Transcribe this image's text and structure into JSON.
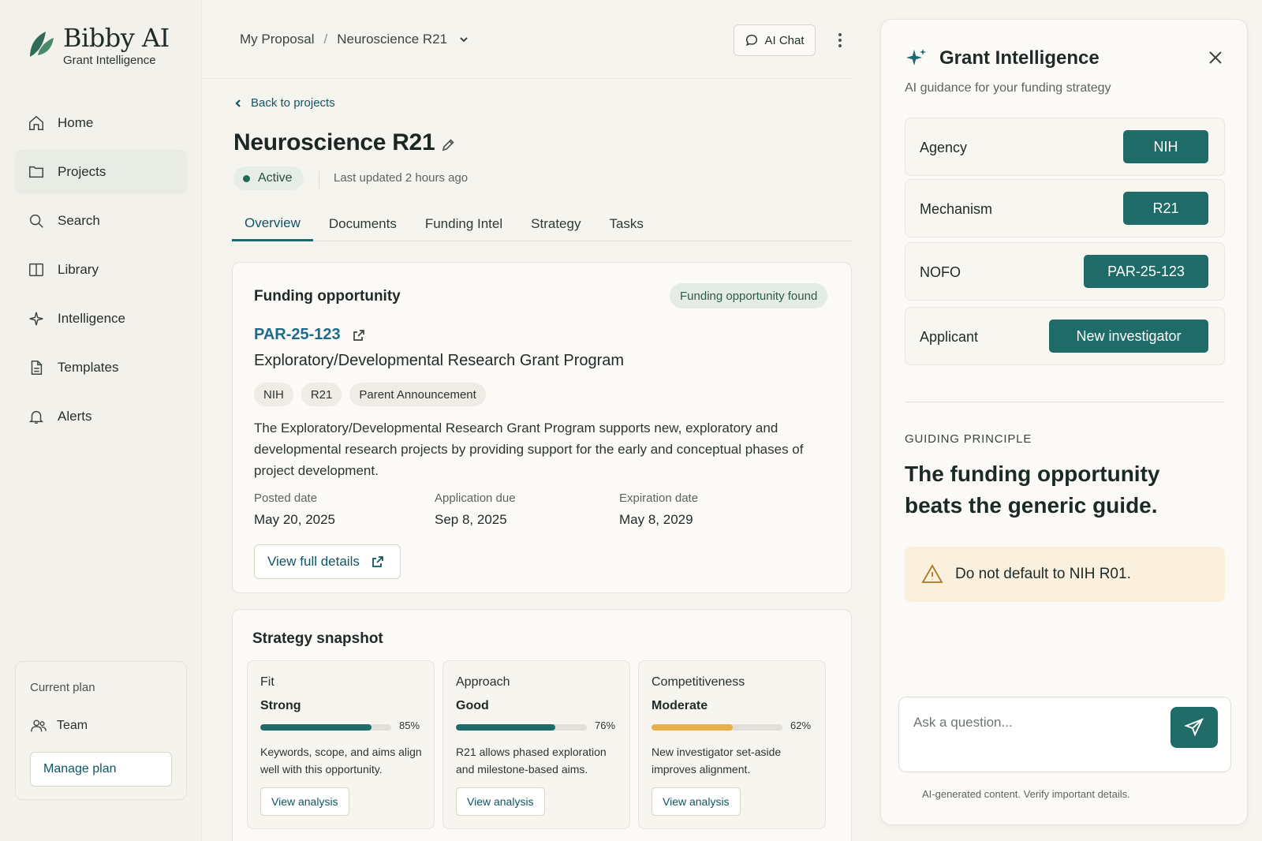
{
  "brand": {
    "name": "Bibby AI",
    "subtitle": "Grant Intelligence"
  },
  "sidebar": {
    "items": [
      {
        "label": "Home",
        "icon": "home-icon"
      },
      {
        "label": "Projects",
        "icon": "folder-icon",
        "active": true
      },
      {
        "label": "Search",
        "icon": "search-icon"
      },
      {
        "label": "Library",
        "icon": "book-icon"
      },
      {
        "label": "Intelligence",
        "icon": "sparkle-icon"
      },
      {
        "label": "Templates",
        "icon": "document-icon"
      },
      {
        "label": "Alerts",
        "icon": "bell-icon"
      }
    ],
    "plan": {
      "label": "Current plan",
      "name": "Team",
      "button": "Manage plan"
    }
  },
  "topbar": {
    "breadcrumb_root": "My Proposal",
    "breadcrumb_sep": "/",
    "breadcrumb_current": "Neuroscience R21",
    "ai_chat": "AI Chat"
  },
  "project": {
    "back": "Back to projects",
    "title": "Neuroscience R21",
    "status": "Active",
    "updated": "Last updated 2 hours ago",
    "tabs": [
      "Overview",
      "Documents",
      "Funding Intel",
      "Strategy",
      "Tasks"
    ],
    "active_tab": "Overview"
  },
  "funding": {
    "title": "Funding opportunity",
    "badge": "Funding opportunity found",
    "nofo": "PAR-25-123",
    "program": "Exploratory/Developmental Research Grant Program",
    "chips": [
      "NIH",
      "R21",
      "Parent Announcement"
    ],
    "description": "The Exploratory/Developmental Research Grant Program supports new, exploratory and developmental research projects by providing support for the early and conceptual phases of project development.",
    "dates": [
      {
        "label": "Posted date",
        "value": "May 20, 2025"
      },
      {
        "label": "Application due",
        "value": "Sep 8, 2025"
      },
      {
        "label": "Expiration date",
        "value": "May 8, 2029"
      }
    ],
    "view_button": "View full details"
  },
  "strategy": {
    "title": "Strategy snapshot",
    "metrics": [
      {
        "name": "Fit",
        "rating": "Strong",
        "percent": 85,
        "percent_label": "85%",
        "color": "#1f6b68",
        "description": "Keywords, scope, and aims align well with this opportunity.",
        "button": "View analysis"
      },
      {
        "name": "Approach",
        "rating": "Good",
        "percent": 76,
        "percent_label": "76%",
        "color": "#1f6b68",
        "description": "R21 allows phased exploration and milestone-based aims.",
        "button": "View analysis"
      },
      {
        "name": "Competitiveness",
        "rating": "Moderate",
        "percent": 62,
        "percent_label": "62%",
        "color": "#e8b04a",
        "description": "New investigator set-aside improves alignment.",
        "button": "View analysis"
      }
    ]
  },
  "panel": {
    "title": "Grant Intelligence",
    "subtitle": "AI guidance for your funding strategy",
    "attributes": [
      {
        "label": "Agency",
        "value": "NIH"
      },
      {
        "label": "Mechanism",
        "value": "R21"
      },
      {
        "label": "NOFO",
        "value": "PAR-25-123"
      },
      {
        "label": "Applicant",
        "value": "New investigator"
      }
    ],
    "guiding_label": "GUIDING PRINCIPLE",
    "guiding_text": "The funding opportunity beats the generic guide.",
    "warning": "Do not default to NIH R01.",
    "ask_placeholder": "Ask a question...",
    "disclaimer": "AI-generated content. Verify important details."
  },
  "colors": {
    "accent": "#1f6b68",
    "link": "#1e6a8c",
    "warning_bg": "#fbf0de",
    "competitiveness_bar": "#e8b04a"
  }
}
